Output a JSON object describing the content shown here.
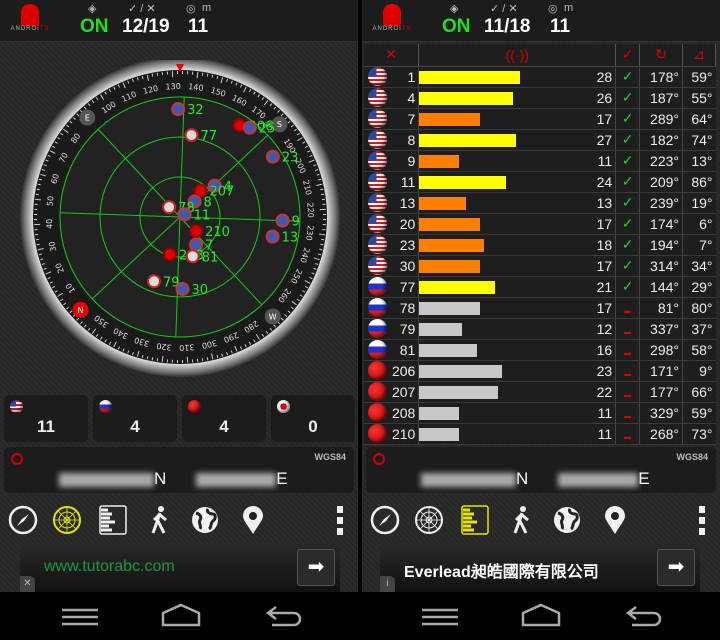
{
  "app": {
    "logo_text": "ANDROI",
    "logo_suffix": "TS"
  },
  "left": {
    "header": {
      "gps_status": "ON",
      "used_visible": "12/19",
      "accuracy": "11",
      "accuracy_unit": "m"
    },
    "constellation_counts": [
      {
        "country": "us",
        "count": "11"
      },
      {
        "country": "ru",
        "count": "4"
      },
      {
        "country": "cn",
        "count": "4"
      },
      {
        "country": "jp",
        "count": "0"
      }
    ],
    "coords": {
      "datum": "WGS84",
      "lat_suffix": "N",
      "lon_suffix": "E"
    },
    "radar": {
      "dial_labels": [
        "10",
        "20",
        "30",
        "40",
        "50",
        "60",
        "70",
        "80",
        "100",
        "110",
        "120",
        "130",
        "140",
        "150",
        "160",
        "170",
        "190",
        "200",
        "210",
        "220",
        "230",
        "240",
        "250",
        "260",
        "280",
        "290",
        "300",
        "310",
        "320",
        "330",
        "340",
        "350"
      ],
      "cardinals": [
        "N",
        "E",
        "S",
        "W"
      ],
      "satellites": [
        {
          "prn": "32",
          "country": "us",
          "az": 132,
          "el": 9
        },
        {
          "prn": "77",
          "country": "ru",
          "az": 141,
          "el": 28
        },
        {
          "prn": "206",
          "country": "cn",
          "az": 166,
          "el": 8
        },
        {
          "prn": "25",
          "country": "us",
          "az": 171,
          "el": 5
        },
        {
          "prn": "23",
          "country": "us",
          "az": 190,
          "el": 7
        },
        {
          "prn": "4",
          "country": "us",
          "az": 181,
          "el": 55
        },
        {
          "prn": "207",
          "country": "cn",
          "az": 171,
          "el": 65
        },
        {
          "prn": "8",
          "country": "us",
          "az": 176,
          "el": 74
        },
        {
          "prn": "78",
          "country": "ru",
          "az": 85,
          "el": 79
        },
        {
          "prn": "11",
          "country": "us",
          "az": 192,
          "el": 86
        },
        {
          "prn": "9",
          "country": "us",
          "az": 225,
          "el": 13
        },
        {
          "prn": "210",
          "country": "cn",
          "az": 264,
          "el": 74
        },
        {
          "prn": "13",
          "country": "us",
          "az": 235,
          "el": 19
        },
        {
          "prn": "7",
          "country": "us",
          "az": 283,
          "el": 66
        },
        {
          "prn": "208",
          "country": "cn",
          "az": 328,
          "el": 61
        },
        {
          "prn": "81",
          "country": "ru",
          "az": 295,
          "el": 59
        },
        {
          "prn": "79",
          "country": "ru",
          "az": 335,
          "el": 38
        },
        {
          "prn": "30",
          "country": "us",
          "az": 311,
          "el": 36
        }
      ]
    },
    "ad": {
      "text": "www.tutorabc.com",
      "close": "✕",
      "arrow": "➡"
    }
  },
  "right": {
    "header": {
      "gps_status": "ON",
      "used_visible": "11/18",
      "accuracy": "11",
      "accuracy_unit": "m"
    },
    "coords": {
      "datum": "WGS84",
      "lat_suffix": "N",
      "lon_suffix": "E"
    },
    "table": {
      "headers": [
        "✕",
        "((·))",
        "✓",
        "↻",
        "⊿"
      ],
      "rows": [
        {
          "country": "us",
          "prn": "1",
          "snr": 28,
          "used": true,
          "az": "178°",
          "el": "59°"
        },
        {
          "country": "us",
          "prn": "4",
          "snr": 26,
          "used": true,
          "az": "187°",
          "el": "55°"
        },
        {
          "country": "us",
          "prn": "7",
          "snr": 17,
          "used": true,
          "az": "289°",
          "el": "64°"
        },
        {
          "country": "us",
          "prn": "8",
          "snr": 27,
          "used": true,
          "az": "182°",
          "el": "74°"
        },
        {
          "country": "us",
          "prn": "9",
          "snr": 11,
          "used": true,
          "az": "223°",
          "el": "13°"
        },
        {
          "country": "us",
          "prn": "11",
          "snr": 24,
          "used": true,
          "az": "209°",
          "el": "86°"
        },
        {
          "country": "us",
          "prn": "13",
          "snr": 13,
          "used": true,
          "az": "239°",
          "el": "19°"
        },
        {
          "country": "us",
          "prn": "20",
          "snr": 17,
          "used": true,
          "az": "174°",
          "el": "6°"
        },
        {
          "country": "us",
          "prn": "23",
          "snr": 18,
          "used": true,
          "az": "194°",
          "el": "7°"
        },
        {
          "country": "us",
          "prn": "30",
          "snr": 17,
          "used": true,
          "az": "314°",
          "el": "34°"
        },
        {
          "country": "ru",
          "prn": "77",
          "snr": 21,
          "used": true,
          "az": "144°",
          "el": "29°"
        },
        {
          "country": "ru",
          "prn": "78",
          "snr": 17,
          "used": false,
          "az": "81°",
          "el": "80°"
        },
        {
          "country": "ru",
          "prn": "79",
          "snr": 12,
          "used": false,
          "az": "337°",
          "el": "37°"
        },
        {
          "country": "ru",
          "prn": "81",
          "snr": 16,
          "used": false,
          "az": "298°",
          "el": "58°"
        },
        {
          "country": "cn",
          "prn": "206",
          "snr": 23,
          "used": false,
          "az": "171°",
          "el": "9°"
        },
        {
          "country": "cn",
          "prn": "207",
          "snr": 22,
          "used": false,
          "az": "177°",
          "el": "66°"
        },
        {
          "country": "cn",
          "prn": "208",
          "snr": 11,
          "used": false,
          "az": "329°",
          "el": "59°"
        },
        {
          "country": "cn",
          "prn": "210",
          "snr": 11,
          "used": false,
          "az": "268°",
          "el": "73°"
        }
      ]
    },
    "ad": {
      "text": "Everlead昶皓國際有限公司",
      "info": "i",
      "arrow": "➡"
    }
  },
  "toolbar": {
    "icons": [
      "compass-icon",
      "radar-icon",
      "satellite-list-icon",
      "walk-icon",
      "globe-icon",
      "map-pin-icon",
      "more-menu-icon"
    ],
    "left_active": "radar-icon",
    "right_active": "satellite-list-icon"
  },
  "colors": {
    "accent_green": "#22dd22",
    "active_yellow": "#e6e600",
    "bar_strong": "#ffff00",
    "bar_used": "#ff8000",
    "bar_unused": "#c8c8c8"
  }
}
